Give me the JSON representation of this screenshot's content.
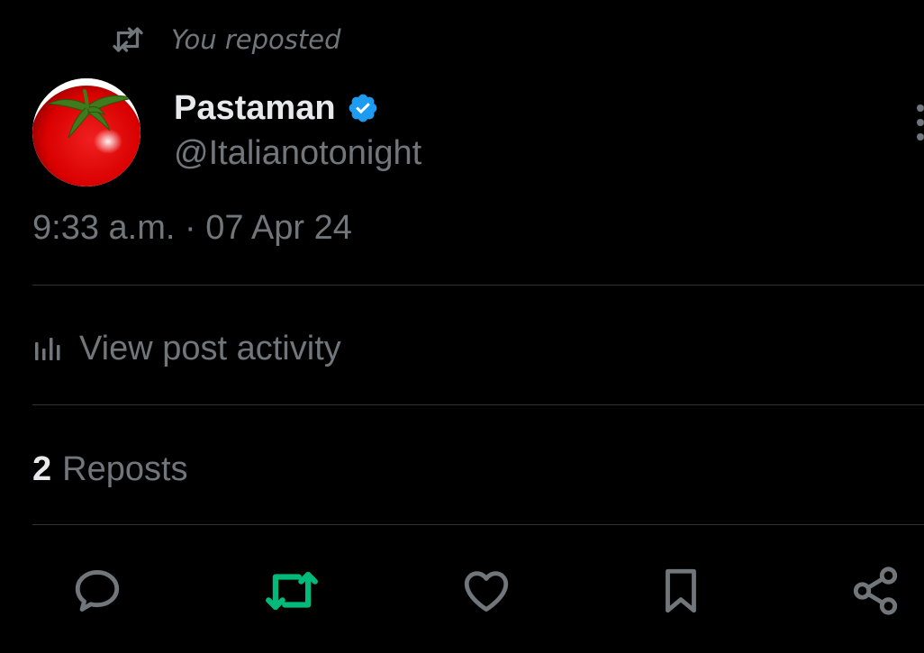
{
  "repost_context": {
    "label": "You reposted",
    "icon": "repost-icon"
  },
  "author": {
    "display_name": "Pastaman",
    "handle": "@Italianotonight",
    "verified": true,
    "avatar": "tomato-avatar"
  },
  "post": {
    "timestamp": "9:33 a.m. · 07 Apr 24"
  },
  "activity": {
    "label": "View post activity",
    "icon": "analytics-icon"
  },
  "stats": {
    "reposts_count": "2",
    "reposts_label": "Reposts"
  },
  "actions": [
    {
      "name": "reply",
      "icon": "reply-icon"
    },
    {
      "name": "repost",
      "icon": "repost-icon",
      "active": true
    },
    {
      "name": "like",
      "icon": "heart-icon"
    },
    {
      "name": "bookmark",
      "icon": "bookmark-icon"
    },
    {
      "name": "share",
      "icon": "share-icon"
    }
  ],
  "colors": {
    "background": "#000000",
    "primary_text": "#e7e9ea",
    "secondary_text": "#71767b",
    "divider": "#2f3336",
    "verified_blue": "#1d9bf0",
    "repost_green": "#00ba7c"
  }
}
